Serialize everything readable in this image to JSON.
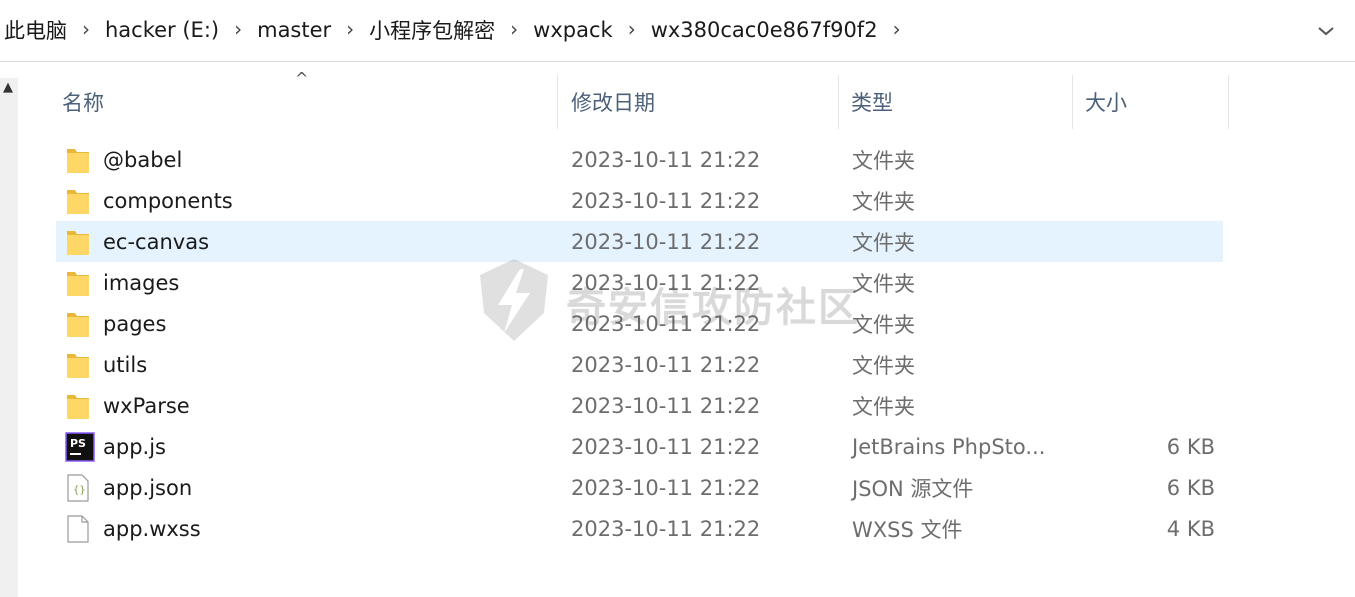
{
  "breadcrumb": {
    "items": [
      "此电脑",
      "hacker (E:)",
      "master",
      "小程序包解密",
      "wxpack",
      "wx380cac0e867f90f2"
    ],
    "separator": "›"
  },
  "columns": {
    "name": "名称",
    "modified": "修改日期",
    "type": "类型",
    "size": "大小"
  },
  "files": [
    {
      "name": "@babel",
      "modified": "2023-10-11 21:22",
      "type": "文件夹",
      "size": "",
      "icon": "folder-icon"
    },
    {
      "name": "components",
      "modified": "2023-10-11 21:22",
      "type": "文件夹",
      "size": "",
      "icon": "folder-icon"
    },
    {
      "name": "ec-canvas",
      "modified": "2023-10-11 21:22",
      "type": "文件夹",
      "size": "",
      "icon": "folder-icon",
      "selected": true
    },
    {
      "name": "images",
      "modified": "2023-10-11 21:22",
      "type": "文件夹",
      "size": "",
      "icon": "folder-icon"
    },
    {
      "name": "pages",
      "modified": "2023-10-11 21:22",
      "type": "文件夹",
      "size": "",
      "icon": "folder-icon"
    },
    {
      "name": "utils",
      "modified": "2023-10-11 21:22",
      "type": "文件夹",
      "size": "",
      "icon": "folder-icon"
    },
    {
      "name": "wxParse",
      "modified": "2023-10-11 21:22",
      "type": "文件夹",
      "size": "",
      "icon": "folder-icon"
    },
    {
      "name": "app.js",
      "modified": "2023-10-11 21:22",
      "type": "JetBrains PhpSto...",
      "size": "6 KB",
      "icon": "phpstorm-file-icon"
    },
    {
      "name": "app.json",
      "modified": "2023-10-11 21:22",
      "type": "JSON 源文件",
      "size": "6 KB",
      "icon": "json-file-icon"
    },
    {
      "name": "app.wxss",
      "modified": "2023-10-11 21:22",
      "type": "WXSS 文件",
      "size": "4 KB",
      "icon": "blank-file-icon"
    }
  ],
  "watermark": {
    "text": "奇安信攻防社区"
  },
  "colors": {
    "selected_row": "#e5f3ff",
    "folder": "#ffd766",
    "header_text": "#4c607a"
  }
}
